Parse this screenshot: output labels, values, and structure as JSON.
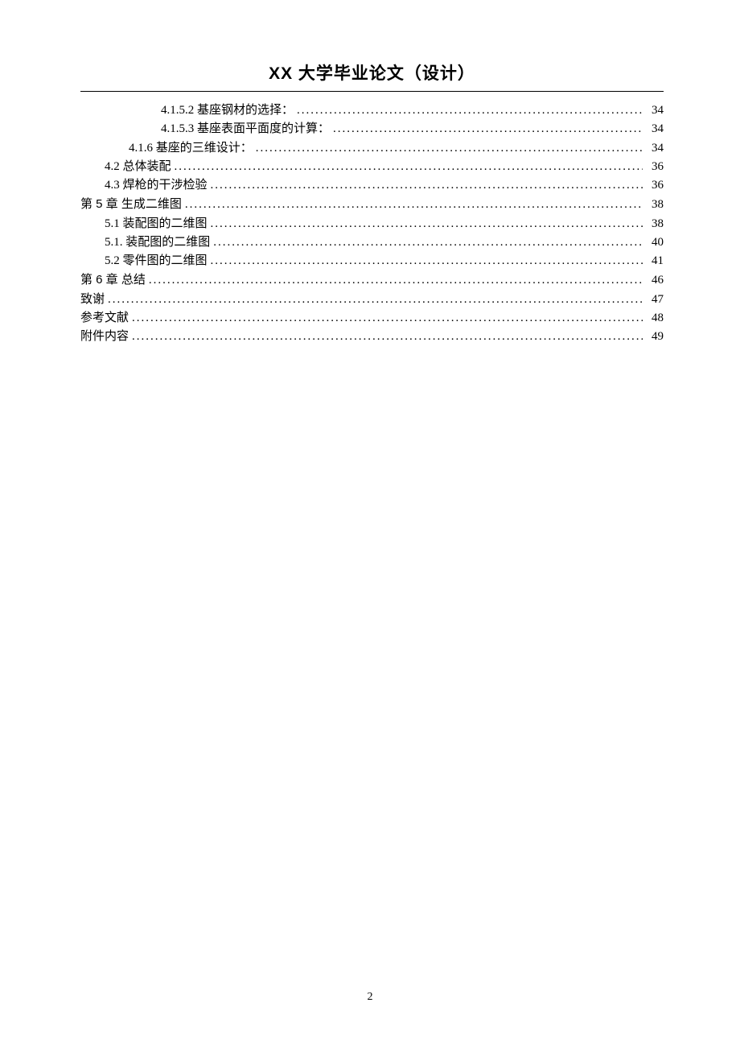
{
  "header": {
    "title": "XX 大学毕业论文（设计）"
  },
  "toc": {
    "entries": [
      {
        "indent": 3,
        "label": "4.1.5.2  基座钢材的选择：",
        "page": "34"
      },
      {
        "indent": 3,
        "label": "4.1.5.3  基座表面平面度的计算：",
        "page": "34"
      },
      {
        "indent": 2,
        "label": "4.1.6  基座的三维设计：",
        "page": "34"
      },
      {
        "indent": 1,
        "label": "4.2 总体装配",
        "page": "36"
      },
      {
        "indent": 1,
        "label": "4.3 焊枪的干涉检验",
        "page": "36"
      },
      {
        "indent": 0,
        "label": "第 5 章 生成二维图",
        "page": "38",
        "chapter": true
      },
      {
        "indent": 1,
        "label": "5.1  装配图的二维图",
        "page": "38"
      },
      {
        "indent": 1,
        "label": "5.1. 装配图的二维图",
        "page": "40"
      },
      {
        "indent": 1,
        "label": "5.2 零件图的二维图",
        "page": "41"
      },
      {
        "indent": 0,
        "label": "第 6 章  总结",
        "page": "46",
        "chapter": true
      },
      {
        "indent": 0,
        "label": "致谢",
        "page": "47"
      },
      {
        "indent": 0,
        "label": "参考文献",
        "page": "48"
      },
      {
        "indent": 0,
        "label": "附件内容",
        "page": "49"
      }
    ]
  },
  "footer": {
    "page_number": "2"
  }
}
